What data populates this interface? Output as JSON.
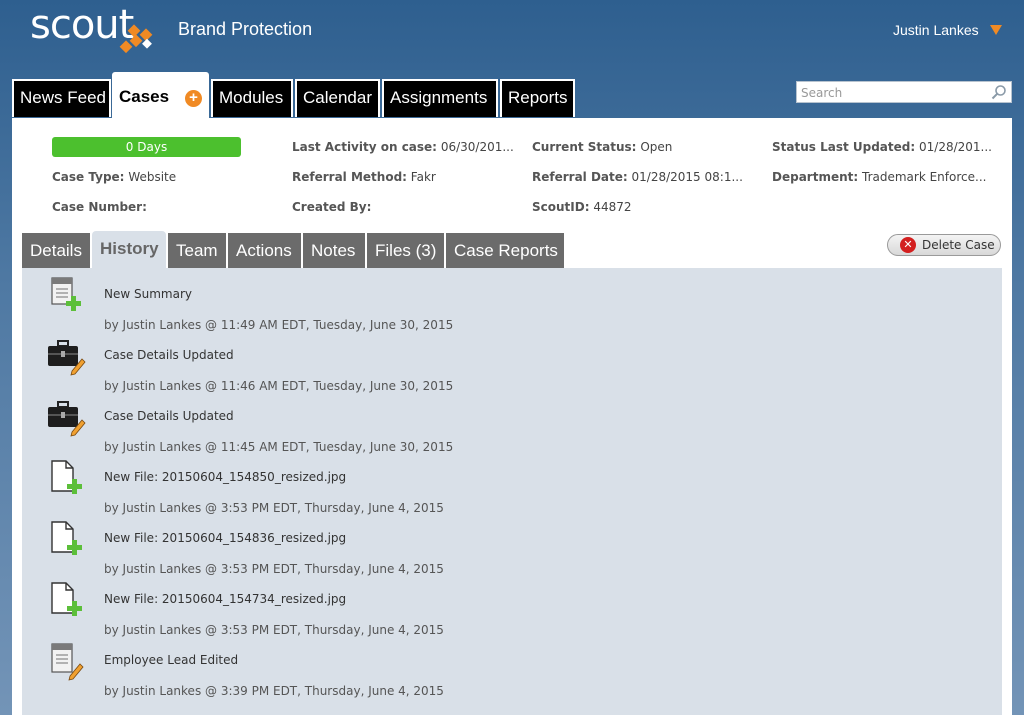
{
  "header": {
    "logo": "scout",
    "app_title": "Brand Protection",
    "user_name": "Justin Lankes"
  },
  "topnav": {
    "tabs": [
      {
        "label": "News Feed"
      },
      {
        "label": "Cases"
      },
      {
        "label": "Modules"
      },
      {
        "label": "Calendar"
      },
      {
        "label": "Assignments"
      },
      {
        "label": "Reports"
      }
    ],
    "active": "Cases",
    "add_badge": "+"
  },
  "search": {
    "placeholder": "Search"
  },
  "case": {
    "days": "0 Days",
    "fields": {
      "last_activity": {
        "label": "Last Activity on case:",
        "value": "06/30/201..."
      },
      "current_status": {
        "label": "Current Status:",
        "value": "Open"
      },
      "status_last_updated": {
        "label": "Status Last Updated:",
        "value": "01/28/201..."
      },
      "case_type": {
        "label": "Case Type:",
        "value": "Website"
      },
      "referral_method": {
        "label": "Referral Method:",
        "value": "Fakr"
      },
      "referral_date": {
        "label": "Referral Date:",
        "value": "01/28/2015 08:1..."
      },
      "department": {
        "label": "Department:",
        "value": "Trademark Enforce..."
      },
      "case_number": {
        "label": "Case Number:",
        "value": ""
      },
      "created_by": {
        "label": "Created By:",
        "value": ""
      },
      "scout_id": {
        "label": "ScoutID:",
        "value": "44872"
      }
    }
  },
  "subtabs": {
    "tabs": [
      {
        "label": "Details"
      },
      {
        "label": "History"
      },
      {
        "label": "Team"
      },
      {
        "label": "Actions"
      },
      {
        "label": "Notes"
      },
      {
        "label": "Files (3)"
      },
      {
        "label": "Case Reports"
      }
    ],
    "active": "History"
  },
  "delete_button": "Delete Case",
  "history": [
    {
      "icon": "summary-add-icon",
      "title": "New Summary",
      "meta": "by Justin Lankes @ 11:49 AM EDT, Tuesday, June 30, 2015"
    },
    {
      "icon": "briefcase-edit-icon",
      "title": "Case Details Updated",
      "meta": "by Justin Lankes @ 11:46 AM EDT, Tuesday, June 30, 2015"
    },
    {
      "icon": "briefcase-edit-icon",
      "title": "Case Details Updated",
      "meta": "by Justin Lankes @ 11:45 AM EDT, Tuesday, June 30, 2015"
    },
    {
      "icon": "file-add-icon",
      "title": "New File: 20150604_154850_resized.jpg",
      "meta": "by Justin Lankes @ 3:53 PM EDT, Thursday, June 4, 2015"
    },
    {
      "icon": "file-add-icon",
      "title": "New File: 20150604_154836_resized.jpg",
      "meta": "by Justin Lankes @ 3:53 PM EDT, Thursday, June 4, 2015"
    },
    {
      "icon": "file-add-icon",
      "title": "New File: 20150604_154734_resized.jpg",
      "meta": "by Justin Lankes @ 3:53 PM EDT, Thursday, June 4, 2015"
    },
    {
      "icon": "document-edit-icon",
      "title": "Employee Lead Edited",
      "meta": "by Justin Lankes @ 3:39 PM EDT, Thursday, June 4, 2015"
    }
  ],
  "colors": {
    "accent": "#f08a24",
    "days_badge": "#4cc02e",
    "history_bg": "#d9e0e8",
    "tab_inactive": "#6b6b6b"
  }
}
